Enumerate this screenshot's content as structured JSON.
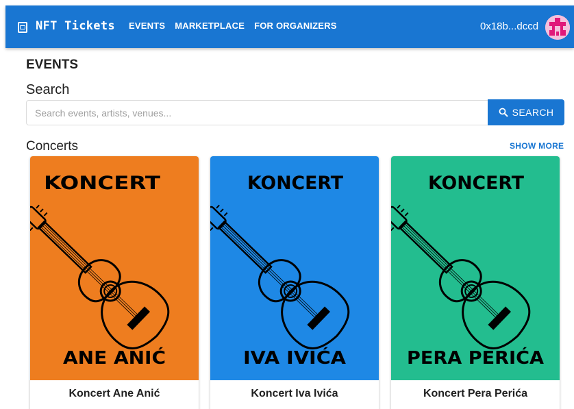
{
  "appbar": {
    "title": "NFT Tickets",
    "nav": [
      "EVENTS",
      "MARKETPLACE",
      "FOR ORGANIZERS"
    ],
    "wallet": "0x18b...dccd",
    "brand_icon": "ticket-icon",
    "color": "#1976d2"
  },
  "page": {
    "heading": "EVENTS"
  },
  "search": {
    "label": "Search",
    "placeholder": "Search events, artists, venues...",
    "value": "",
    "button_label": "SEARCH",
    "button_icon": "search-icon"
  },
  "concerts": {
    "title": "Concerts",
    "show_more": "SHOW MORE",
    "cards": [
      {
        "poster_top": "KONCERT",
        "poster_bottom": "ANE ANIĆ",
        "title": "Koncert Ane Anić",
        "color": "#ee7d1f"
      },
      {
        "poster_top": "KONCERT",
        "poster_bottom": "IVA IVIĆA",
        "title": "Koncert Iva Ivića",
        "color": "#1e88e5"
      },
      {
        "poster_top": "KONCERT",
        "poster_bottom": "PERA PERIĆA",
        "title": "Koncert Pera Perića",
        "color": "#23bd8f"
      }
    ]
  }
}
